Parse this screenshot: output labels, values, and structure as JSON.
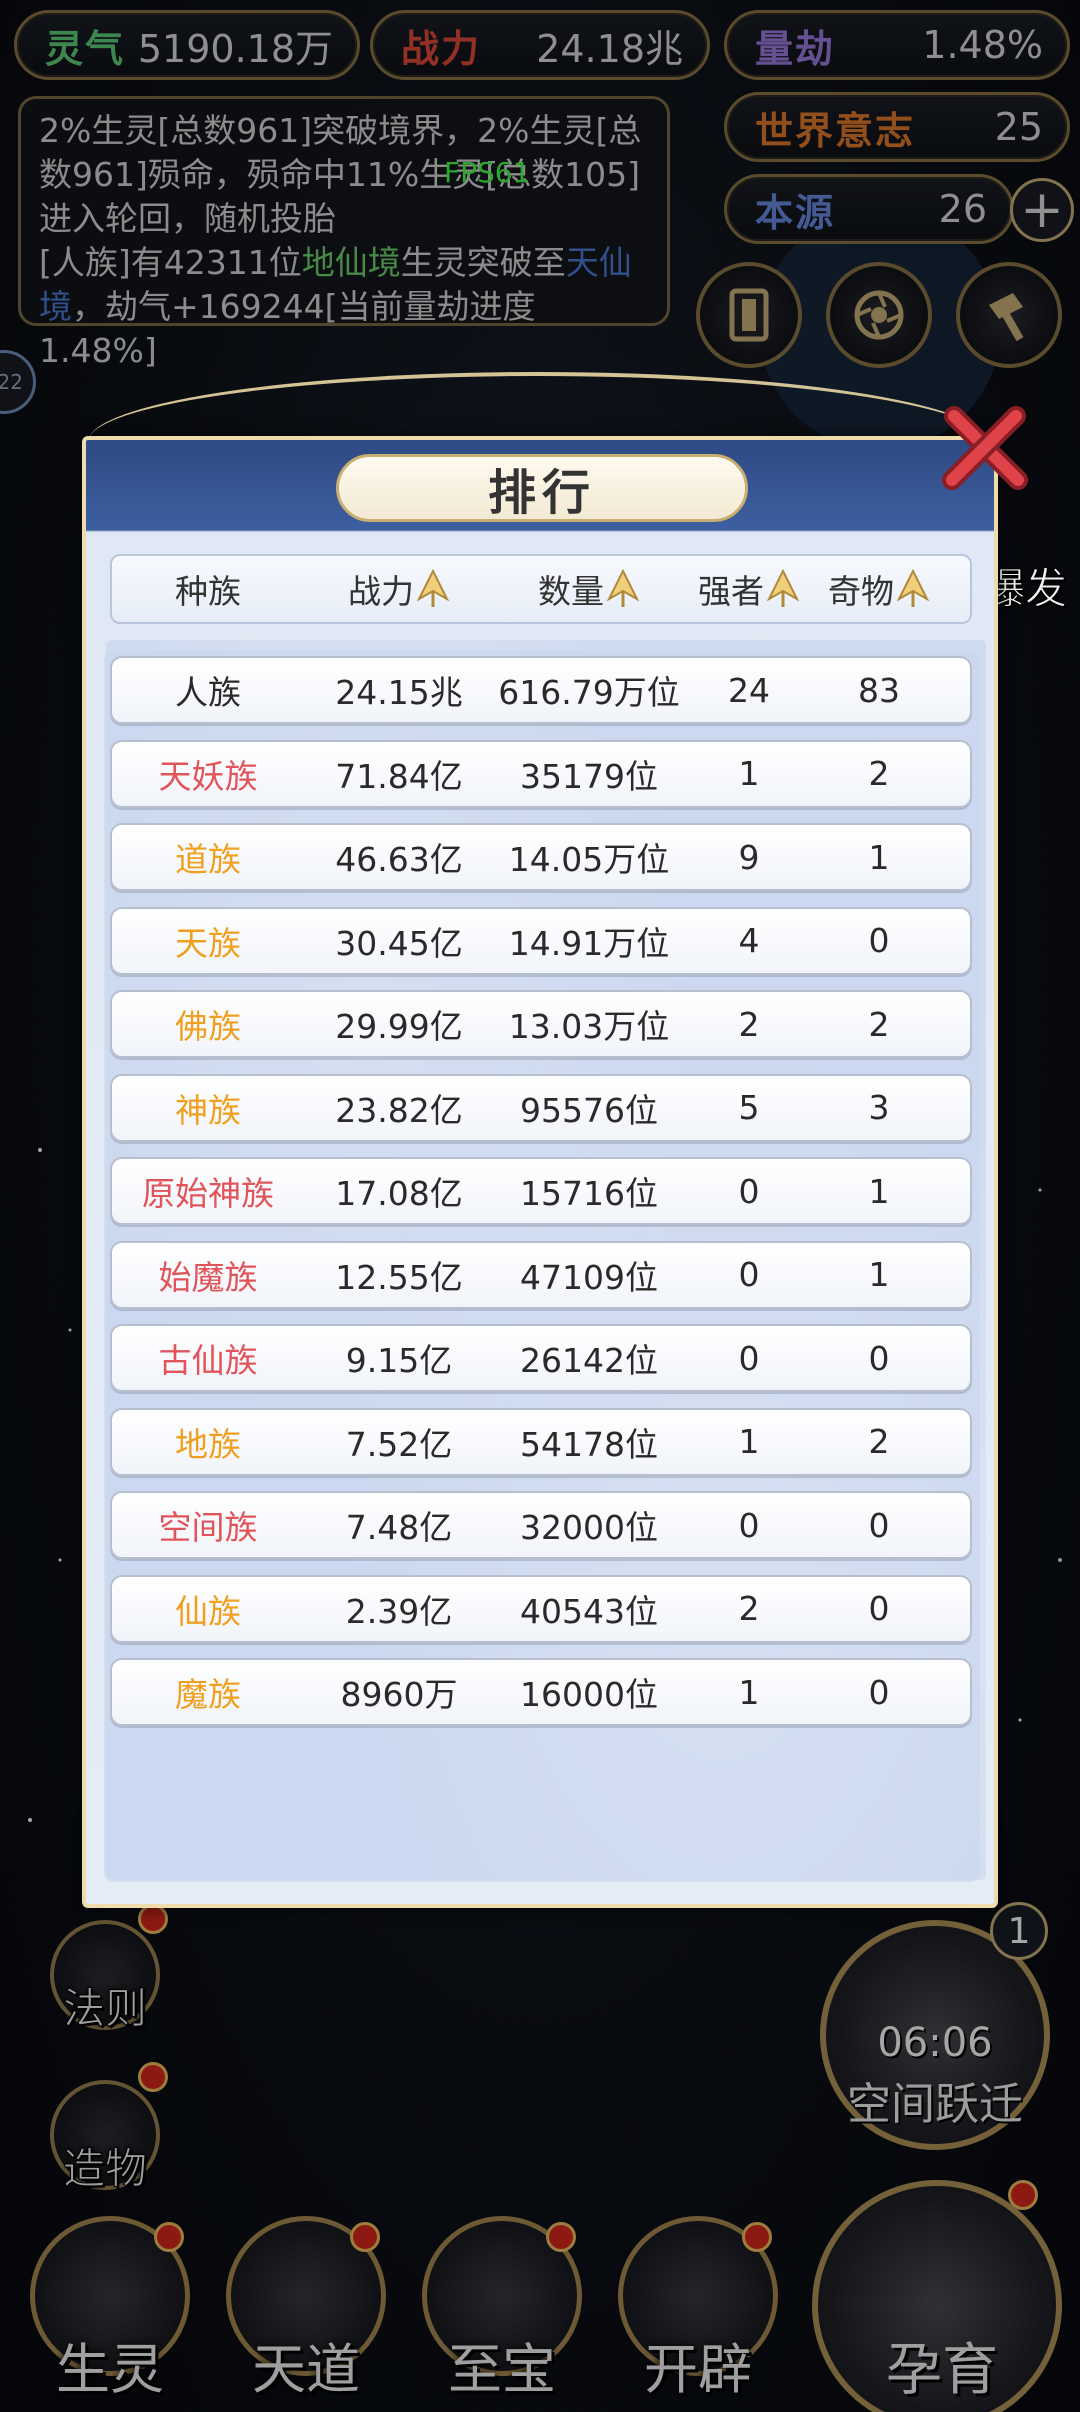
{
  "hud": {
    "lingqi": {
      "label": "灵气",
      "value": "5190.18万",
      "color": "#5fd07a"
    },
    "zhanli": {
      "label": "战力",
      "value": "24.18兆",
      "color": "#e04a3a"
    },
    "liangjie": {
      "label": "量劫",
      "value": "1.48%",
      "color": "#9b7be0"
    },
    "shijie": {
      "label": "世界意志",
      "value": "25",
      "color": "#e07a2a"
    },
    "benyuan": {
      "label": "本源",
      "value": "26",
      "color": "#6a8be0"
    },
    "plus": "+",
    "fps": "FPS61",
    "edge_badge": "22"
  },
  "messages": {
    "line1": "2%生灵[总数961]突破境界，2%生灵[总数961]殒命，殒命中11%生灵[总数105]进入轮回，随机投胎",
    "line2_a": "[人族]有42311位",
    "line2_b": "地仙境",
    "line2_c": "生灵突破至",
    "line2_d": "天仙境",
    "line2_e": "，劫气+169244[当前量劫进度1.48%]"
  },
  "dialog": {
    "title": "排行",
    "headers": [
      "种族",
      "战力",
      "数量",
      "强者",
      "奇物"
    ],
    "rows": [
      {
        "race": "人族",
        "color": "#2a2a2a",
        "power": "24.15兆",
        "count": "616.79万位",
        "strong": "24",
        "items": "83"
      },
      {
        "race": "天妖族",
        "color": "#e0555a",
        "power": "71.84亿",
        "count": "35179位",
        "strong": "1",
        "items": "2"
      },
      {
        "race": "道族",
        "color": "#f0a020",
        "power": "46.63亿",
        "count": "14.05万位",
        "strong": "9",
        "items": "1"
      },
      {
        "race": "天族",
        "color": "#f0a020",
        "power": "30.45亿",
        "count": "14.91万位",
        "strong": "4",
        "items": "0"
      },
      {
        "race": "佛族",
        "color": "#f0a020",
        "power": "29.99亿",
        "count": "13.03万位",
        "strong": "2",
        "items": "2"
      },
      {
        "race": "神族",
        "color": "#f0a020",
        "power": "23.82亿",
        "count": "95576位",
        "strong": "5",
        "items": "3"
      },
      {
        "race": "原始神族",
        "color": "#e0555a",
        "power": "17.08亿",
        "count": "15716位",
        "strong": "0",
        "items": "1"
      },
      {
        "race": "始魔族",
        "color": "#e0555a",
        "power": "12.55亿",
        "count": "47109位",
        "strong": "0",
        "items": "1"
      },
      {
        "race": "古仙族",
        "color": "#e0555a",
        "power": "9.15亿",
        "count": "26142位",
        "strong": "0",
        "items": "0"
      },
      {
        "race": "地族",
        "color": "#f0a020",
        "power": "7.52亿",
        "count": "54178位",
        "strong": "1",
        "items": "2"
      },
      {
        "race": "空间族",
        "color": "#e0555a",
        "power": "7.48亿",
        "count": "32000位",
        "strong": "0",
        "items": "0"
      },
      {
        "race": "仙族",
        "color": "#f0a020",
        "power": "2.39亿",
        "count": "40543位",
        "strong": "2",
        "items": "0"
      },
      {
        "race": "魔族",
        "color": "#f0a020",
        "power": "8960万",
        "count": "16000位",
        "strong": "1",
        "items": "0"
      }
    ]
  },
  "side": {
    "faze": "法则",
    "zaowu": "造物",
    "right_top": "爆发",
    "space_jump_time": "06:06",
    "space_jump_label": "空间跃迁",
    "space_jump_count": "1"
  },
  "nav": {
    "shengling": "生灵",
    "tiandao": "天道",
    "zhibao": "至宝",
    "kaipi": "开辟",
    "yunyu": "孕育"
  }
}
